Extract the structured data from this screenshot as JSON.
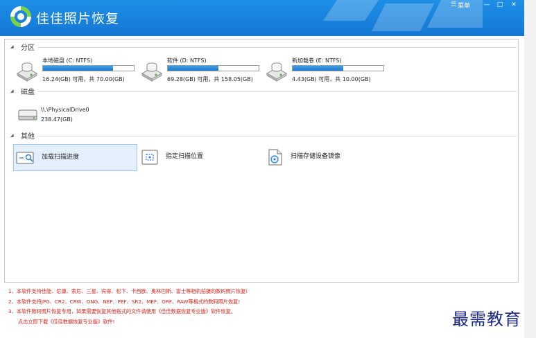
{
  "app": {
    "title": "佳佳照片恢复",
    "menu_label": "菜单"
  },
  "window_controls": {
    "minimize": "—",
    "maximize": "□",
    "close": "✕"
  },
  "sections": {
    "partitions": {
      "title": "分区"
    },
    "disks": {
      "title": "磁盘"
    },
    "other": {
      "title": "其他"
    }
  },
  "partitions": [
    {
      "name": "本地磁盘 (C: NTFS)",
      "size_text": "16.24(GB) 可用，共 70.00(GB)",
      "used_fraction": 0.77
    },
    {
      "name": "软件 (D: NTFS)",
      "size_text": "69.28(GB) 可用，共 158.05(GB)",
      "used_fraction": 0.56
    },
    {
      "name": "新加载卷 (E: NTFS)",
      "size_text": "4.43(GB) 可用，共 10.00(GB)",
      "used_fraction": 0.56
    }
  ],
  "disks": [
    {
      "name": "\\\\.\\PhysicalDrive0",
      "size_text": "238.47(GB)"
    }
  ],
  "other_actions": [
    {
      "label": "加载扫描进度",
      "icon": "load-scan-progress-icon",
      "selected": true
    },
    {
      "label": "指定扫描位置",
      "icon": "specify-scan-location-icon",
      "selected": false
    },
    {
      "label": "扫描存储设备镜像",
      "icon": "scan-device-image-icon",
      "selected": false
    }
  ],
  "notes": [
    "1、本软件支持佳能、尼康、索尼、三星、宾得、松下、卡西欧、奥林巴斯、富士等相机拍摄的数码照片恢复!",
    "2、本软件支持JPG、CR2、CRW、DNG、NEF、PEF、SR2、MEF、ORF、RAW等格式的数码照片恢复!",
    "3、本软件数码照片恢复专用，如果需要恢复其他格式的文件请使用《佳佳数据恢复专业版》软件恢复。",
    "点击立即下载《佳佳数据恢复专业版》软件!"
  ],
  "watermark": "最需教育",
  "colors": {
    "titlebar": "#1477d4",
    "progress": "#1e7cd0",
    "note_red": "#d9241b",
    "selected_bg": "#e3effc"
  }
}
